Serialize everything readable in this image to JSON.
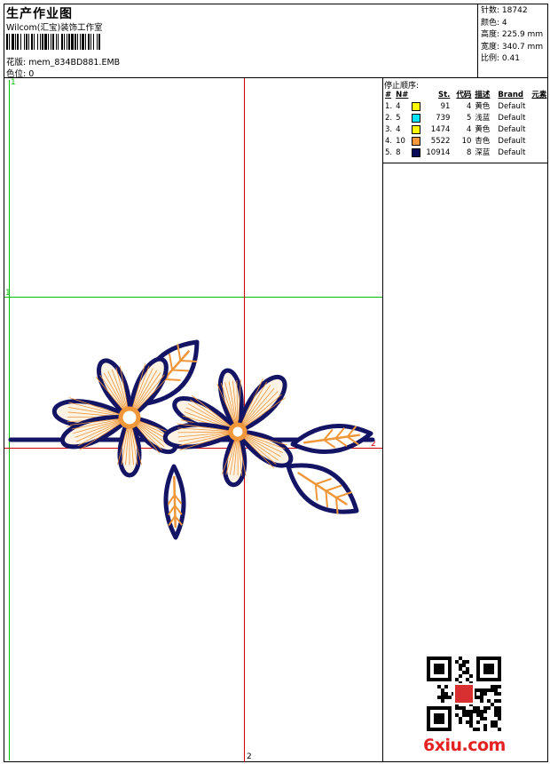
{
  "header": {
    "title": "生产作业图",
    "subtitle": "Wilcom(汇宝)装饰工作室",
    "file_line": "花版: mem_834BD881.EMB",
    "pos_line": "色位: 0"
  },
  "info": {
    "rows": [
      {
        "label": "针数",
        "value": "18742"
      },
      {
        "label": "颜色",
        "value": "4"
      },
      {
        "label": "高度",
        "value": "225.9 mm"
      },
      {
        "label": "宽度",
        "value": "340.7 mm"
      },
      {
        "label": "比例",
        "value": "0.41"
      }
    ]
  },
  "stops": {
    "title": "停止顺序:",
    "headers": {
      "num": "#",
      "needle": "N#",
      "st": "St.",
      "code": "代码",
      "desc": "描述",
      "brand": "Brand",
      "element": "元素"
    },
    "rows": [
      {
        "num": "1.",
        "needle": "4",
        "color": "#ffff00",
        "st": "91",
        "code": "4",
        "desc": "黄色",
        "brand": "Default"
      },
      {
        "num": "2.",
        "needle": "5",
        "color": "#00e5ff",
        "st": "739",
        "code": "5",
        "desc": "浅蓝",
        "brand": "Default"
      },
      {
        "num": "3.",
        "needle": "4",
        "color": "#ffff00",
        "st": "1474",
        "code": "4",
        "desc": "黄色",
        "brand": "Default"
      },
      {
        "num": "4.",
        "needle": "10",
        "color": "#ff9940",
        "st": "5522",
        "code": "10",
        "desc": "杏色",
        "brand": "Default"
      },
      {
        "num": "5.",
        "needle": "8",
        "color": "#0a0a5a",
        "st": "10914",
        "code": "8",
        "desc": "深蓝",
        "brand": "Default"
      }
    ]
  },
  "guides": {
    "top_left": "1",
    "left_mid": "1",
    "bottom": "2",
    "right": "2"
  },
  "colors": {
    "outline": "#141464",
    "fill": "#fdf3e4",
    "stitch": "#f0973a",
    "green": "#00c000",
    "red": "#d00000"
  },
  "watermark": "6xiu.com"
}
